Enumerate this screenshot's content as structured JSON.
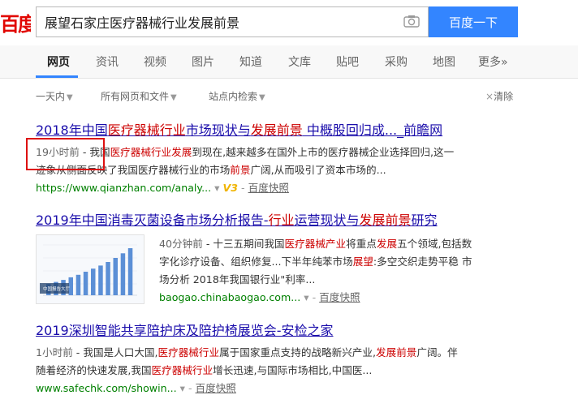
{
  "logo": "百度",
  "search": {
    "value": "展望石家庄医疗器械行业发展前景",
    "button": "百度一下"
  },
  "tabs": [
    "网页",
    "资讯",
    "视频",
    "图片",
    "知道",
    "文库",
    "贴吧",
    "采购",
    "地图",
    "更多»"
  ],
  "filters": {
    "time": "一天内",
    "type": "所有网页和文件",
    "site": "站点内检索",
    "clear": "清除"
  },
  "results": [
    {
      "title_pre": "2018年中国",
      "title_hl": "医疗器械行业",
      "title_mid": "市场现状与",
      "title_hl2": "发展前景",
      "title_post": " 中概股回归成..._前瞻网",
      "time": "19小时前",
      "abs1_pre": " - 我国",
      "abs1_hl": "医疗器械行业发展",
      "abs1_post": "到现在,越来越多在国外上市的医疗器械企业选择回归,这一",
      "abs2_pre": "迹象从侧面反映了我国医疗器械行业的市场",
      "abs2_hl": "前景",
      "abs2_post": "广阔,从而吸引了资本市场的...",
      "url": "https://www.qianzhan.com/analy...",
      "v3": "V3",
      "kuaizhao": "百度快照"
    },
    {
      "title_pre": "2019年中国消毒灭菌设备市场分析报告-",
      "title_hl": "行业",
      "title_mid": "运营现状与",
      "title_hl2": "发展前景",
      "title_post": "研究",
      "time": "40分钟前",
      "abs1_pre": " - 十三五期间我国",
      "abs1_hl": "医疗器械产业",
      "abs1_mid": "将重点",
      "abs1_hl2": "发展",
      "abs1_post": "五个领域,包括数",
      "abs2_pre": "字化诊疗设备、组织修复...下半年纯苯市场",
      "abs2_hl": "展望",
      "abs2_post": ":多空交织走势平稳 市",
      "abs3": "场分析 2018年我国银行业\"利率...",
      "url": "baogao.chinabaogao.com...",
      "kuaizhao": "百度快照"
    },
    {
      "title": "2019深圳智能共享陪护床及陪护椅展览会-安检之家",
      "time": "1小时前",
      "abs1_pre": " - 我国是人口大国,",
      "abs1_hl": "医疗器械行业",
      "abs1_mid": "属于国家重点支持的战略新兴产业,",
      "abs1_hl2": "发展前景",
      "abs1_post": "广阔。伴",
      "abs2_pre": "随着经济的快速发展,我国",
      "abs2_hl": "医疗器械行业",
      "abs2_post": "增长迅速,与国际市场相比,中国医...",
      "url": "www.safechk.com/showin...",
      "kuaizhao": "百度快照"
    }
  ],
  "thumb": {
    "values": [
      22,
      26,
      30,
      35,
      40,
      46,
      52,
      58,
      65,
      73,
      82,
      92
    ],
    "bar_color": "#5b8fd6",
    "watermark": "中国报告大厅"
  }
}
